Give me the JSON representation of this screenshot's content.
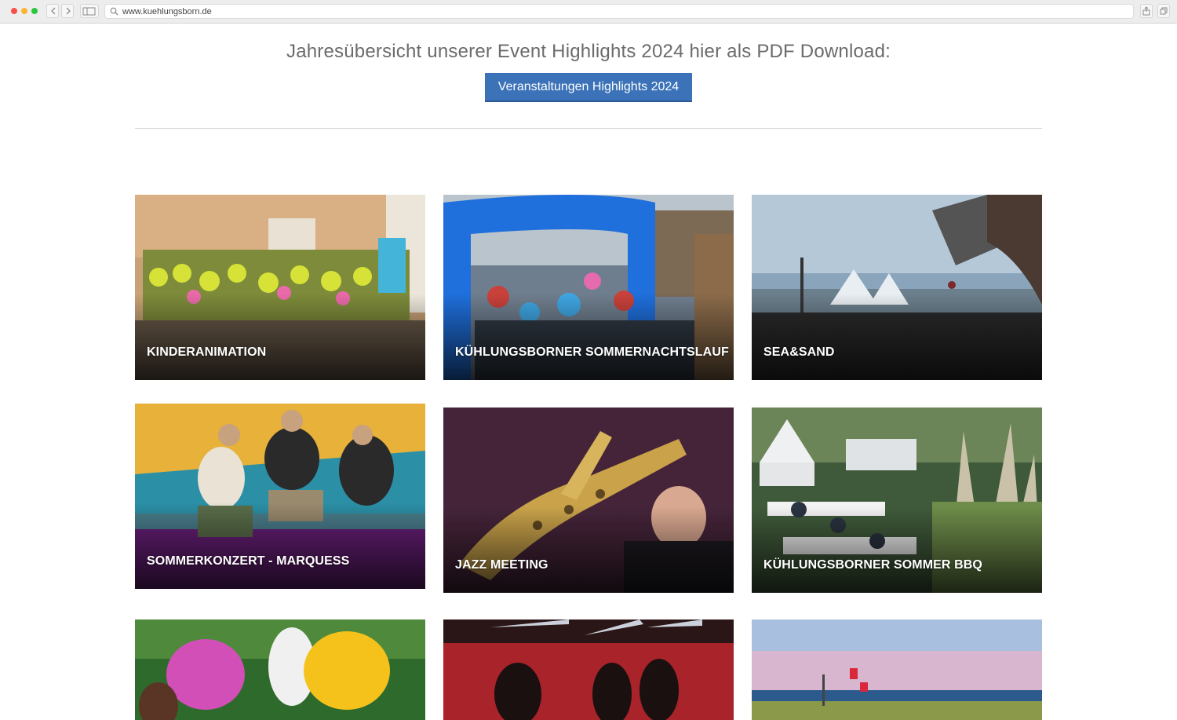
{
  "browser": {
    "url": "www.kuehlungsborn.de"
  },
  "header": {
    "headline": "Jahresübersicht unserer Event Highlights 2024 hier als PDF Download:",
    "download_button": "Veranstaltungen Highlights 2024"
  },
  "events": [
    {
      "title": "KINDERANIMATION"
    },
    {
      "title": "KÜHLUNGSBORNER SOMMERNACHTSLAUF"
    },
    {
      "title": "SEA&SAND"
    },
    {
      "title": "SOMMERKONZERT - MARQUESS"
    },
    {
      "title": "JAZZ MEETING"
    },
    {
      "title": "KÜHLUNGSBORNER SOMMER BBQ"
    },
    {
      "title": ""
    },
    {
      "title": ""
    },
    {
      "title": ""
    }
  ],
  "colors": {
    "button": "#3b72b8",
    "headline": "#6b6b6b"
  }
}
